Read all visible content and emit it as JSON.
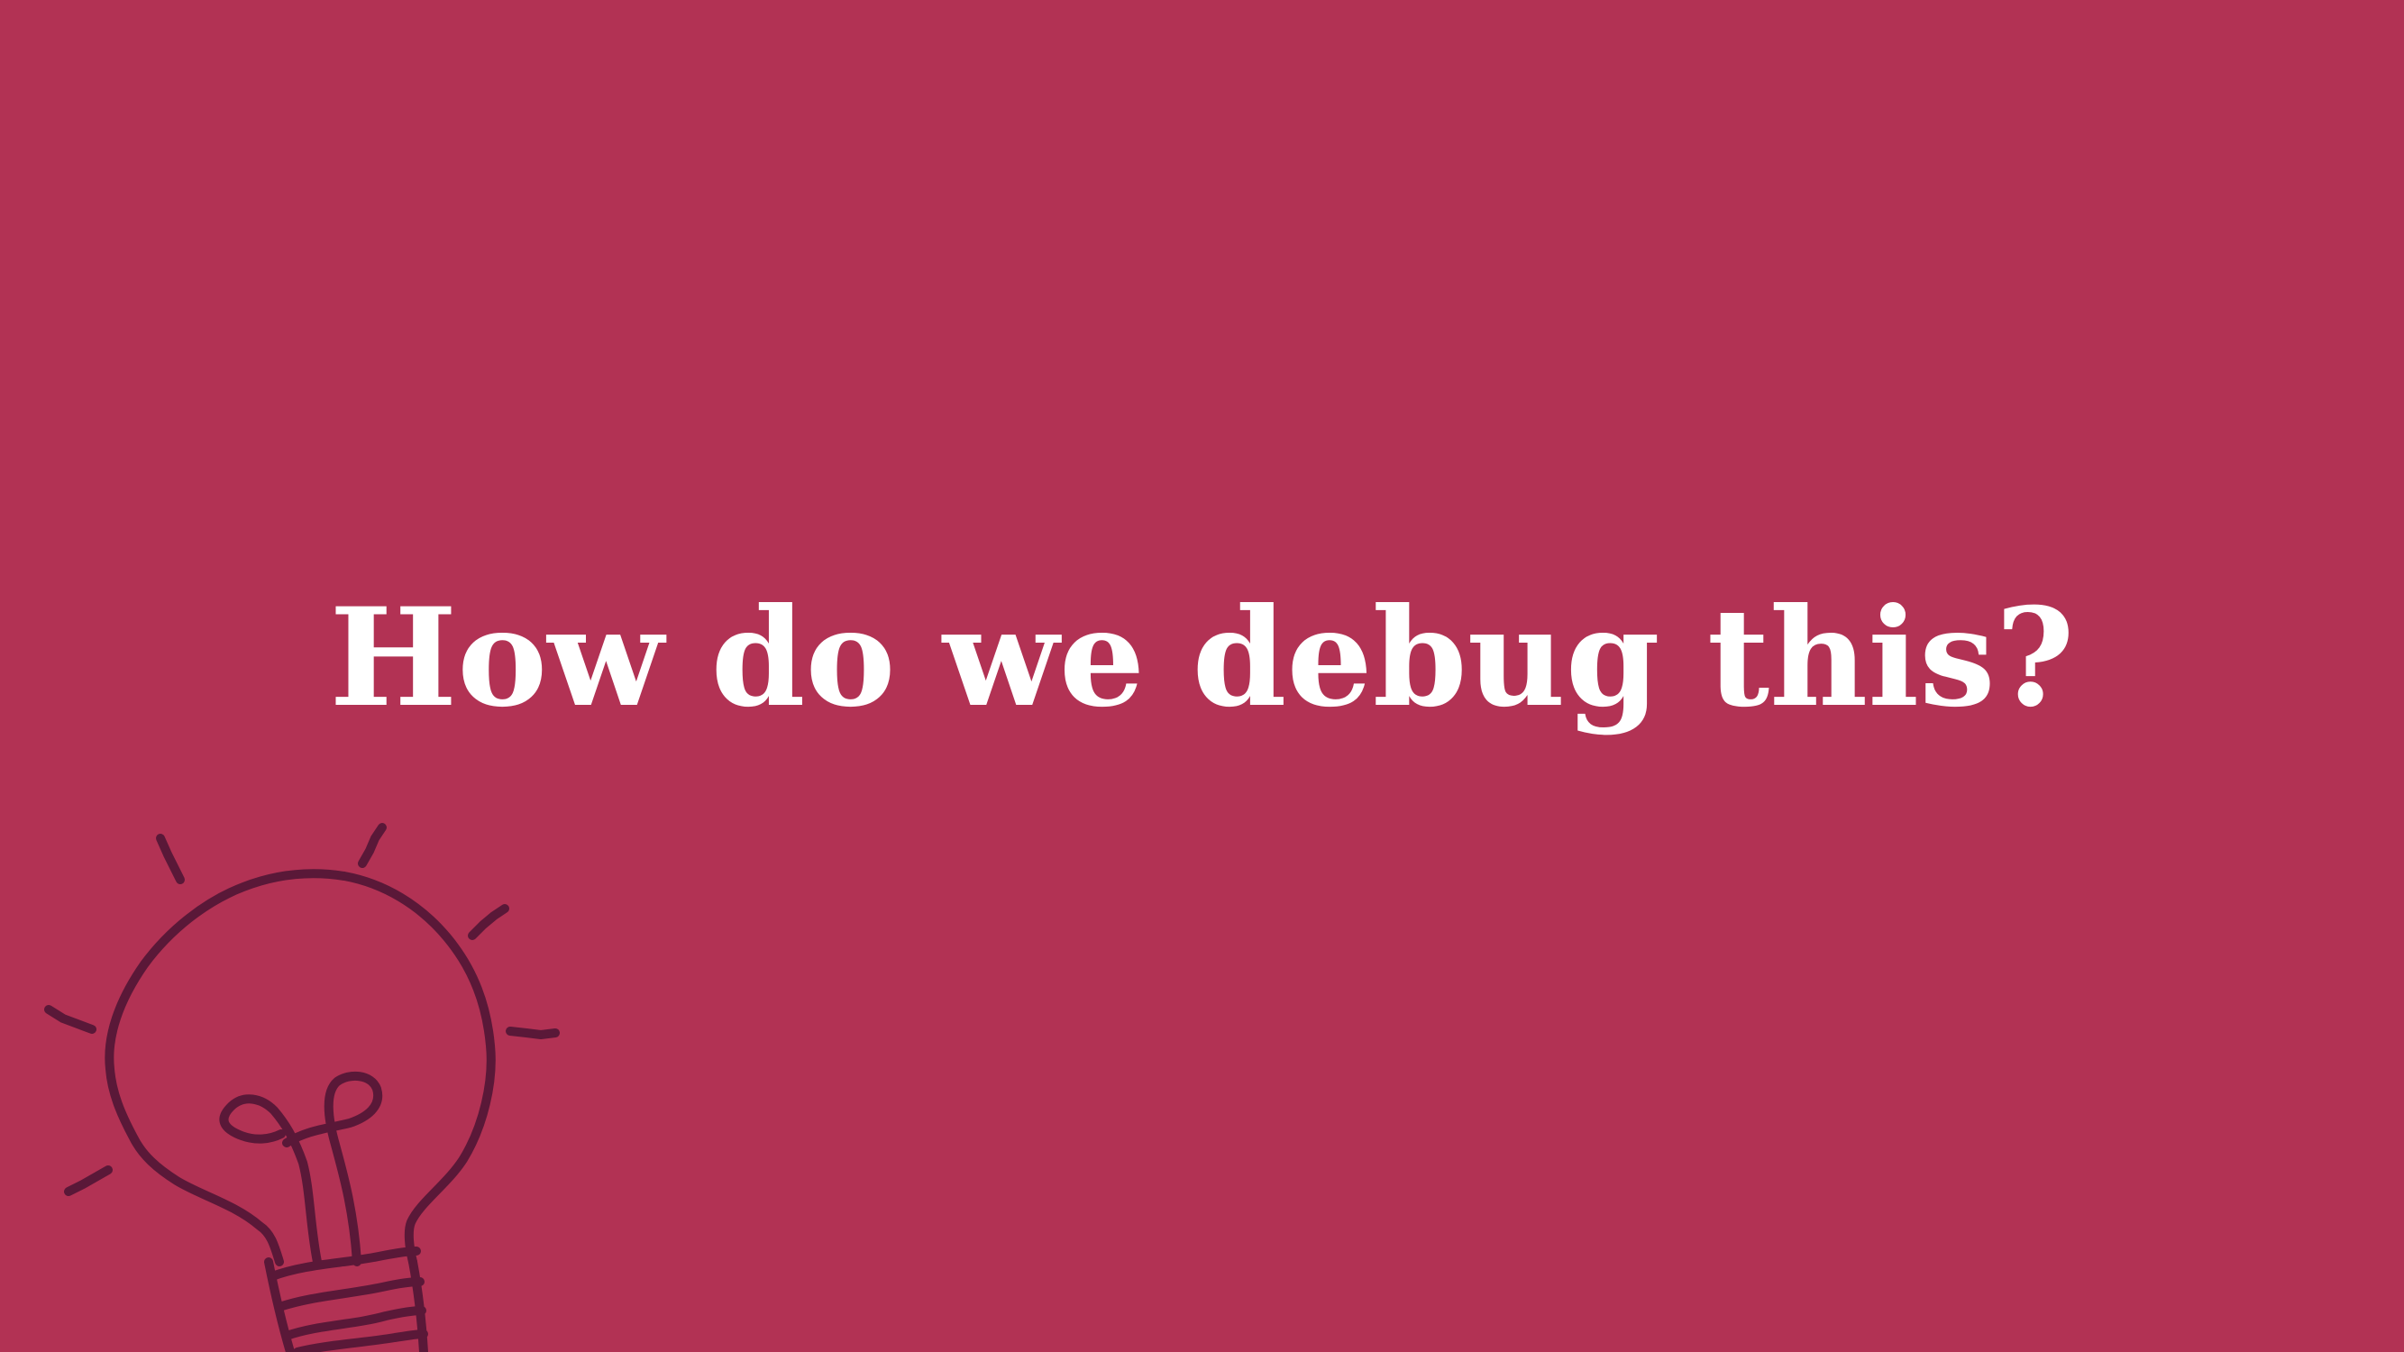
{
  "slide": {
    "title": "How do we debug this?",
    "background_color": "#b23254",
    "title_color": "#ffffff",
    "illustration_color": "#5a1838",
    "illustration_icon": "lightbulb-icon"
  }
}
